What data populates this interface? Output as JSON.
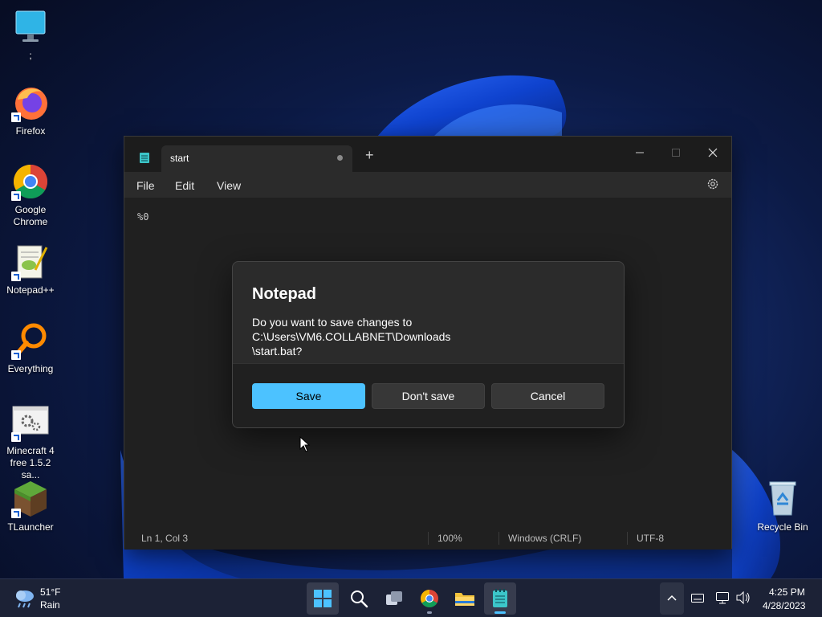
{
  "desktop": {
    "icons": [
      {
        "label": ";",
        "icon": "monitor-icon"
      },
      {
        "label": "Firefox",
        "icon": "firefox-icon"
      },
      {
        "label": "Google Chrome",
        "icon": "chrome-icon"
      },
      {
        "label": "Notepad++",
        "icon": "notepadpp-icon"
      },
      {
        "label": "Everything",
        "icon": "everything-search-icon"
      },
      {
        "label": "Minecraft 4 free 1.5.2 sa...",
        "icon": "settings-file-icon"
      },
      {
        "label": "TLauncher",
        "icon": "grass-block-icon"
      }
    ],
    "recycle_bin": {
      "label": "Recycle Bin",
      "icon": "recycle-bin-icon"
    }
  },
  "notepad": {
    "tab_title": "start",
    "new_tab_symbol": "+",
    "menu": {
      "file": "File",
      "edit": "Edit",
      "view": "View"
    },
    "editor_text": "%0",
    "status": {
      "position": "Ln 1, Col 3",
      "zoom": "100%",
      "line_ending": "Windows (CRLF)",
      "encoding": "UTF-8"
    }
  },
  "dialog": {
    "title": "Notepad",
    "message_line1": "Do you want to save changes to C:\\Users\\VM6.COLLABNET\\Downloads",
    "message_line2": "\\start.bat?",
    "save_label": "Save",
    "dont_save_label": "Don't save",
    "cancel_label": "Cancel"
  },
  "taskbar": {
    "weather_temp": "51°F",
    "weather_cond": "Rain",
    "time": "4:25 PM",
    "date": "4/28/2023"
  },
  "colors": {
    "accent": "#4cc2ff",
    "window_bg": "#202020",
    "dialog_bg": "#2b2b2b"
  }
}
